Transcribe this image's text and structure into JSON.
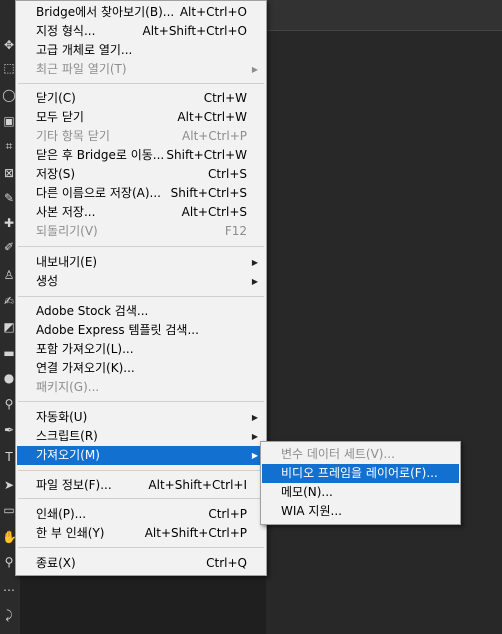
{
  "file_menu": {
    "items": [
      {
        "label": "Bridge에서 찾아보기(B)...",
        "shortcut": "Alt+Ctrl+O",
        "disabled": false,
        "submenu": false
      },
      {
        "label": "지정 형식...",
        "shortcut": "Alt+Shift+Ctrl+O",
        "disabled": false,
        "submenu": false
      },
      {
        "label": "고급 개체로 열기...",
        "shortcut": "",
        "disabled": false,
        "submenu": false
      },
      {
        "label": "최근 파일 열기(T)",
        "shortcut": "",
        "disabled": true,
        "submenu": true
      },
      {
        "label": "닫기(C)",
        "shortcut": "Ctrl+W",
        "disabled": false,
        "submenu": false
      },
      {
        "label": "모두 닫기",
        "shortcut": "Alt+Ctrl+W",
        "disabled": false,
        "submenu": false
      },
      {
        "label": "기타 항목 닫기",
        "shortcut": "Alt+Ctrl+P",
        "disabled": true,
        "submenu": false
      },
      {
        "label": "닫은 후 Bridge로 이동...",
        "shortcut": "Shift+Ctrl+W",
        "disabled": false,
        "submenu": false
      },
      {
        "label": "저장(S)",
        "shortcut": "Ctrl+S",
        "disabled": false,
        "submenu": false
      },
      {
        "label": "다른 이름으로 저장(A)...",
        "shortcut": "Shift+Ctrl+S",
        "disabled": false,
        "submenu": false
      },
      {
        "label": "사본 저장...",
        "shortcut": "Alt+Ctrl+S",
        "disabled": false,
        "submenu": false
      },
      {
        "label": "되돌리기(V)",
        "shortcut": "F12",
        "disabled": true,
        "submenu": false
      },
      {
        "label": "내보내기(E)",
        "shortcut": "",
        "disabled": false,
        "submenu": true
      },
      {
        "label": "생성",
        "shortcut": "",
        "disabled": false,
        "submenu": true
      },
      {
        "label": "Adobe Stock 검색...",
        "shortcut": "",
        "disabled": false,
        "submenu": false
      },
      {
        "label": "Adobe Express 템플릿 검색...",
        "shortcut": "",
        "disabled": false,
        "submenu": false
      },
      {
        "label": "포함 가져오기(L)...",
        "shortcut": "",
        "disabled": false,
        "submenu": false
      },
      {
        "label": "연결 가져오기(K)...",
        "shortcut": "",
        "disabled": false,
        "submenu": false
      },
      {
        "label": "패키지(G)...",
        "shortcut": "",
        "disabled": true,
        "submenu": false
      },
      {
        "label": "자동화(U)",
        "shortcut": "",
        "disabled": false,
        "submenu": true
      },
      {
        "label": "스크립트(R)",
        "shortcut": "",
        "disabled": false,
        "submenu": true
      },
      {
        "label": "가져오기(M)",
        "shortcut": "",
        "disabled": false,
        "submenu": true,
        "selected": true
      },
      {
        "label": "파일 정보(F)...",
        "shortcut": "Alt+Shift+Ctrl+I",
        "disabled": false,
        "submenu": false
      },
      {
        "label": "인쇄(P)...",
        "shortcut": "Ctrl+P",
        "disabled": false,
        "submenu": false
      },
      {
        "label": "한 부 인쇄(Y)",
        "shortcut": "Alt+Shift+Ctrl+P",
        "disabled": false,
        "submenu": false
      },
      {
        "label": "종료(X)",
        "shortcut": "Ctrl+Q",
        "disabled": false,
        "submenu": false
      }
    ]
  },
  "import_submenu": {
    "items": [
      {
        "label": "변수 데이터 세트(V)...",
        "disabled": true
      },
      {
        "label": "비디오 프레임을 레이어로(F)...",
        "disabled": false,
        "selected": true
      },
      {
        "label": "메모(N)...",
        "disabled": false
      },
      {
        "label": "WIA 지원...",
        "disabled": false
      }
    ]
  },
  "toolbar": {
    "tools": [
      {
        "name": "move-tool-icon",
        "glyph": "✥"
      },
      {
        "name": "marquee-tool-icon",
        "glyph": "⬚"
      },
      {
        "name": "lasso-tool-icon",
        "glyph": "◯"
      },
      {
        "name": "object-select-tool-icon",
        "glyph": "▣"
      },
      {
        "name": "crop-tool-icon",
        "glyph": "⌗"
      },
      {
        "name": "frame-tool-icon",
        "glyph": "⊠"
      },
      {
        "name": "eyedropper-tool-icon",
        "glyph": "✎"
      },
      {
        "name": "healing-brush-tool-icon",
        "glyph": "✚"
      },
      {
        "name": "brush-tool-icon",
        "glyph": "✐"
      },
      {
        "name": "stamp-tool-icon",
        "glyph": "♙"
      },
      {
        "name": "history-brush-tool-icon",
        "glyph": "✍"
      },
      {
        "name": "eraser-tool-icon",
        "glyph": "◩"
      },
      {
        "name": "gradient-tool-icon",
        "glyph": "▬"
      },
      {
        "name": "blur-tool-icon",
        "glyph": "●"
      },
      {
        "name": "dodge-tool-icon",
        "glyph": "⚲"
      },
      {
        "name": "pen-tool-icon",
        "glyph": "✒"
      },
      {
        "name": "type-tool-icon",
        "glyph": "T"
      },
      {
        "name": "path-select-tool-icon",
        "glyph": "➤"
      },
      {
        "name": "rectangle-tool-icon",
        "glyph": "▭"
      },
      {
        "name": "hand-tool-icon",
        "glyph": "✋"
      },
      {
        "name": "zoom-tool-icon",
        "glyph": "⚲"
      },
      {
        "name": "more-tools-icon",
        "glyph": "⋯"
      },
      {
        "name": "swap-colors-icon",
        "glyph": "⤸"
      }
    ]
  },
  "colors": {
    "menu_bg": "#f2f2f2",
    "highlight": "#1170d0",
    "disabled_text": "#8d8d8d",
    "app_bg": "#1f1f1f"
  }
}
